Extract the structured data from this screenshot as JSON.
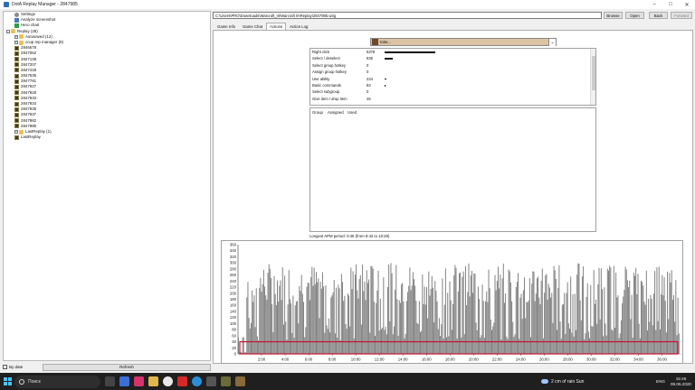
{
  "window": {
    "title": "DotA Replay Manager - 2847985"
  },
  "tree": {
    "items": [
      {
        "label": "Settings",
        "icon": "gear-icon",
        "level": 1
      },
      {
        "label": "Analyze screenshot",
        "icon": "screen-icon",
        "level": 1
      },
      {
        "label": "Hero chart",
        "icon": "chart-icon",
        "level": 1
      },
      {
        "label": "Replay (28)",
        "icon": "folder-icon",
        "level": 0,
        "expander": "-"
      },
      {
        "label": "Autosaved (12)",
        "icon": "folder-icon",
        "level": 1,
        "expander": "+"
      },
      {
        "label": "ccup rep manager (8)",
        "icon": "folder-icon",
        "level": 1,
        "expander": "+"
      },
      {
        "label": "2846678",
        "icon": "replay-icon",
        "level": 1
      },
      {
        "label": "2847062",
        "icon": "replay-icon",
        "level": 1
      },
      {
        "label": "2847138",
        "icon": "replay-icon",
        "level": 1
      },
      {
        "label": "2847207",
        "icon": "replay-icon",
        "level": 1
      },
      {
        "label": "2847448",
        "icon": "replay-icon",
        "level": 1
      },
      {
        "label": "2847535",
        "icon": "replay-icon",
        "level": 1
      },
      {
        "label": "2847781",
        "icon": "replay-icon",
        "level": 1
      },
      {
        "label": "2847927",
        "icon": "replay-icon",
        "level": 1
      },
      {
        "label": "2847928",
        "icon": "replay-icon",
        "level": 1
      },
      {
        "label": "2847933",
        "icon": "replay-icon",
        "level": 1
      },
      {
        "label": "2847934",
        "icon": "replay-icon",
        "level": 1
      },
      {
        "label": "2847935",
        "icon": "replay-icon",
        "level": 1
      },
      {
        "label": "2847937",
        "icon": "replay-icon",
        "level": 1
      },
      {
        "label": "2847982",
        "icon": "replay-icon",
        "level": 1
      },
      {
        "label": "2847985",
        "icon": "replay-icon",
        "level": 1
      },
      {
        "label": "LastReplay (1)",
        "icon": "folder-icon",
        "level": 1,
        "expander": "+"
      },
      {
        "label": "LastReplay",
        "icon": "replay-icon",
        "level": 1
      }
    ]
  },
  "bottom": {
    "checkbox_label": "By date",
    "refresh_label": "Refresh"
  },
  "path": {
    "value": "C:\\Users\\PRO\\Downloads\\Warcraft_III\\Warcraft III\\Replay\\2847985.w3g"
  },
  "buttons": {
    "browse": "Browse",
    "open": "Open",
    "back": "Back",
    "forward": "Forward"
  },
  "tabs": [
    "Game Info",
    "Game Chat",
    "Actions",
    "Action Log"
  ],
  "active_tab": 2,
  "player": {
    "name": "totw..."
  },
  "stats": [
    {
      "label": "Right click",
      "value": "5378",
      "bar": 1.0
    },
    {
      "label": "Select / deselect",
      "value": "835",
      "bar": 0.16
    },
    {
      "label": "Select group hotkey",
      "value": "0",
      "bar": 0
    },
    {
      "label": "Assign group hotkey",
      "value": "0",
      "bar": 0
    },
    {
      "label": "Use ability",
      "value": "224",
      "bar": 0.04
    },
    {
      "label": "Basic commands",
      "value": "83",
      "bar": 0.015
    },
    {
      "label": "Select subgroup",
      "value": "0",
      "bar": 0
    },
    {
      "label": "Give item / drop item",
      "value": "26",
      "bar": 0
    }
  ],
  "groups": {
    "headers": [
      "Group",
      "Assigned",
      "Used"
    ]
  },
  "apm": {
    "text": "Longest APM period: 0:45 (from 9:42 to 10:28)"
  },
  "chart_data": {
    "type": "bar",
    "y_ticks": [
      0,
      20,
      40,
      60,
      80,
      100,
      120,
      140,
      160,
      180,
      200,
      220,
      240,
      260,
      280,
      300,
      320,
      340,
      360
    ],
    "x_ticks": [
      "2:00",
      "4:00",
      "6:00",
      "8:00",
      "10:00",
      "12:00",
      "14:00",
      "16:00",
      "18:00",
      "20:00",
      "22:00",
      "24:00",
      "26:00",
      "28:00",
      "30:00",
      "32:00",
      "34:00",
      "36:00"
    ],
    "ylim": [
      0,
      360
    ],
    "xlim_minutes": [
      0,
      37.5
    ],
    "highlight_band": [
      0,
      40
    ],
    "highlight_color": "#c8102e",
    "bar_color": "#808080",
    "grid": false
  },
  "taskbar": {
    "search_placeholder": "Поиск",
    "weather": "2 cm of rain Sun",
    "lang": "ENG",
    "time": "15:46",
    "date": "09.05.2020"
  }
}
